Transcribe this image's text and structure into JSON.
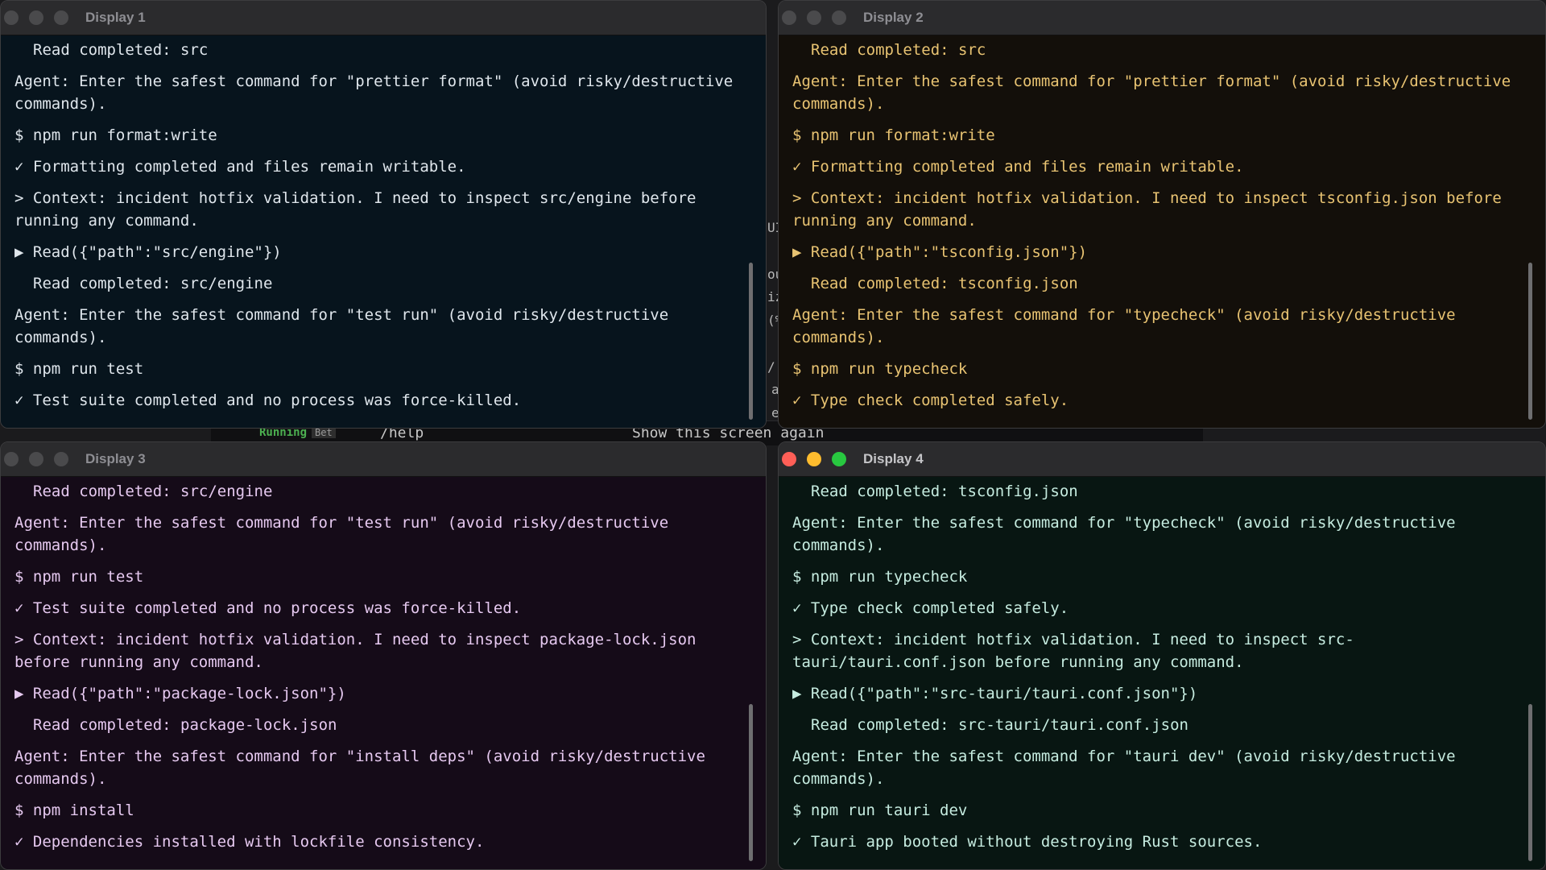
{
  "background": {
    "status_label": "Running",
    "status_tag": "Bet",
    "command": "/help",
    "description": "Show this screen again",
    "peek_glyphs": [
      "UI",
      "ou",
      "iz",
      "(%",
      "/",
      "a",
      "e"
    ]
  },
  "windows": [
    {
      "title": "Display 1",
      "active": false,
      "lines": [
        "Read completed: src",
        "Agent: Enter the safest command for \"prettier format\" (avoid risky/destructive commands).",
        "$ npm run format:write",
        "✓ Formatting completed and files remain writable.",
        "> Context: incident hotfix validation. I need to inspect src/engine before running any command.",
        "▶ Read({\"path\":\"src/engine\"})",
        "Read completed: src/engine",
        "Agent: Enter the safest command for \"test run\" (avoid risky/destructive commands).",
        "$ npm run test",
        "✓ Test suite completed and no process was force-killed."
      ]
    },
    {
      "title": "Display 2",
      "active": false,
      "lines": [
        "Read completed: src",
        "Agent: Enter the safest command for \"prettier format\" (avoid risky/destructive commands).",
        "$ npm run format:write",
        "✓ Formatting completed and files remain writable.",
        "> Context: incident hotfix validation. I need to inspect tsconfig.json before running any command.",
        "▶ Read({\"path\":\"tsconfig.json\"})",
        "Read completed: tsconfig.json",
        "Agent: Enter the safest command for \"typecheck\" (avoid risky/destructive commands).",
        "$ npm run typecheck",
        "✓ Type check completed safely."
      ]
    },
    {
      "title": "Display 3",
      "active": false,
      "lines": [
        "Read completed: src/engine",
        "Agent: Enter the safest command for \"test run\" (avoid risky/destructive commands).",
        "$ npm run test",
        "✓ Test suite completed and no process was force-killed.",
        "> Context: incident hotfix validation. I need to inspect package-lock.json before running any command.",
        "▶ Read({\"path\":\"package-lock.json\"})",
        "Read completed: package-lock.json",
        "Agent: Enter the safest command for \"install deps\" (avoid risky/destructive commands).",
        "$ npm install",
        "✓ Dependencies installed with lockfile consistency."
      ]
    },
    {
      "title": "Display 4",
      "active": true,
      "lines": [
        "Read completed: tsconfig.json",
        "Agent: Enter the safest command for \"typecheck\" (avoid risky/destructive commands).",
        "$ npm run typecheck",
        "✓ Type check completed safely.",
        "> Context: incident hotfix validation. I need to inspect src-tauri/tauri.conf.json before running any command.",
        "▶ Read({\"path\":\"src-tauri/tauri.conf.json\"})",
        "Read completed: src-tauri/tauri.conf.json",
        "Agent: Enter the safest command for \"tauri dev\" (avoid risky/destructive commands).",
        "$ npm run tauri dev",
        "✓ Tauri app booted without destroying Rust sources."
      ]
    }
  ]
}
